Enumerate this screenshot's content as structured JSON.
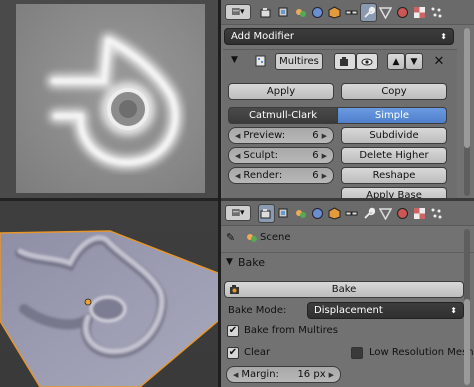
{
  "top_panel": {
    "add_modifier_label": "Add Modifier",
    "modifier": {
      "name": "Multires",
      "apply_label": "Apply",
      "copy_label": "Copy",
      "subdiv_types": [
        "Catmull-Clark",
        "Simple"
      ],
      "selected_subdiv_type": "Simple",
      "preview": {
        "label": "Preview:",
        "value": "6"
      },
      "sculpt": {
        "label": "Sculpt:",
        "value": "6"
      },
      "render": {
        "label": "Render:",
        "value": "6"
      },
      "subdivide_label": "Subdivide",
      "delete_higher_label": "Delete Higher",
      "reshape_label": "Reshape",
      "apply_base_label": "Apply Base"
    }
  },
  "bottom_panel": {
    "breadcrumb": "Scene",
    "bake_section_title": "Bake",
    "bake_button_label": "Bake",
    "bake_mode_label": "Bake Mode:",
    "bake_mode_value": "Displacement",
    "bake_from_multires": {
      "label": "Bake from Multires",
      "checked": true
    },
    "clear": {
      "label": "Clear",
      "checked": true
    },
    "low_res_mesh": {
      "label": "Low Resolution Mesh",
      "checked": false
    },
    "margin": {
      "label": "Margin:",
      "value": "16 px"
    }
  },
  "colors": {
    "selected_button": "#5a8ad8",
    "panel_bg": "#727272",
    "mesh_outline": "#e8962a"
  }
}
